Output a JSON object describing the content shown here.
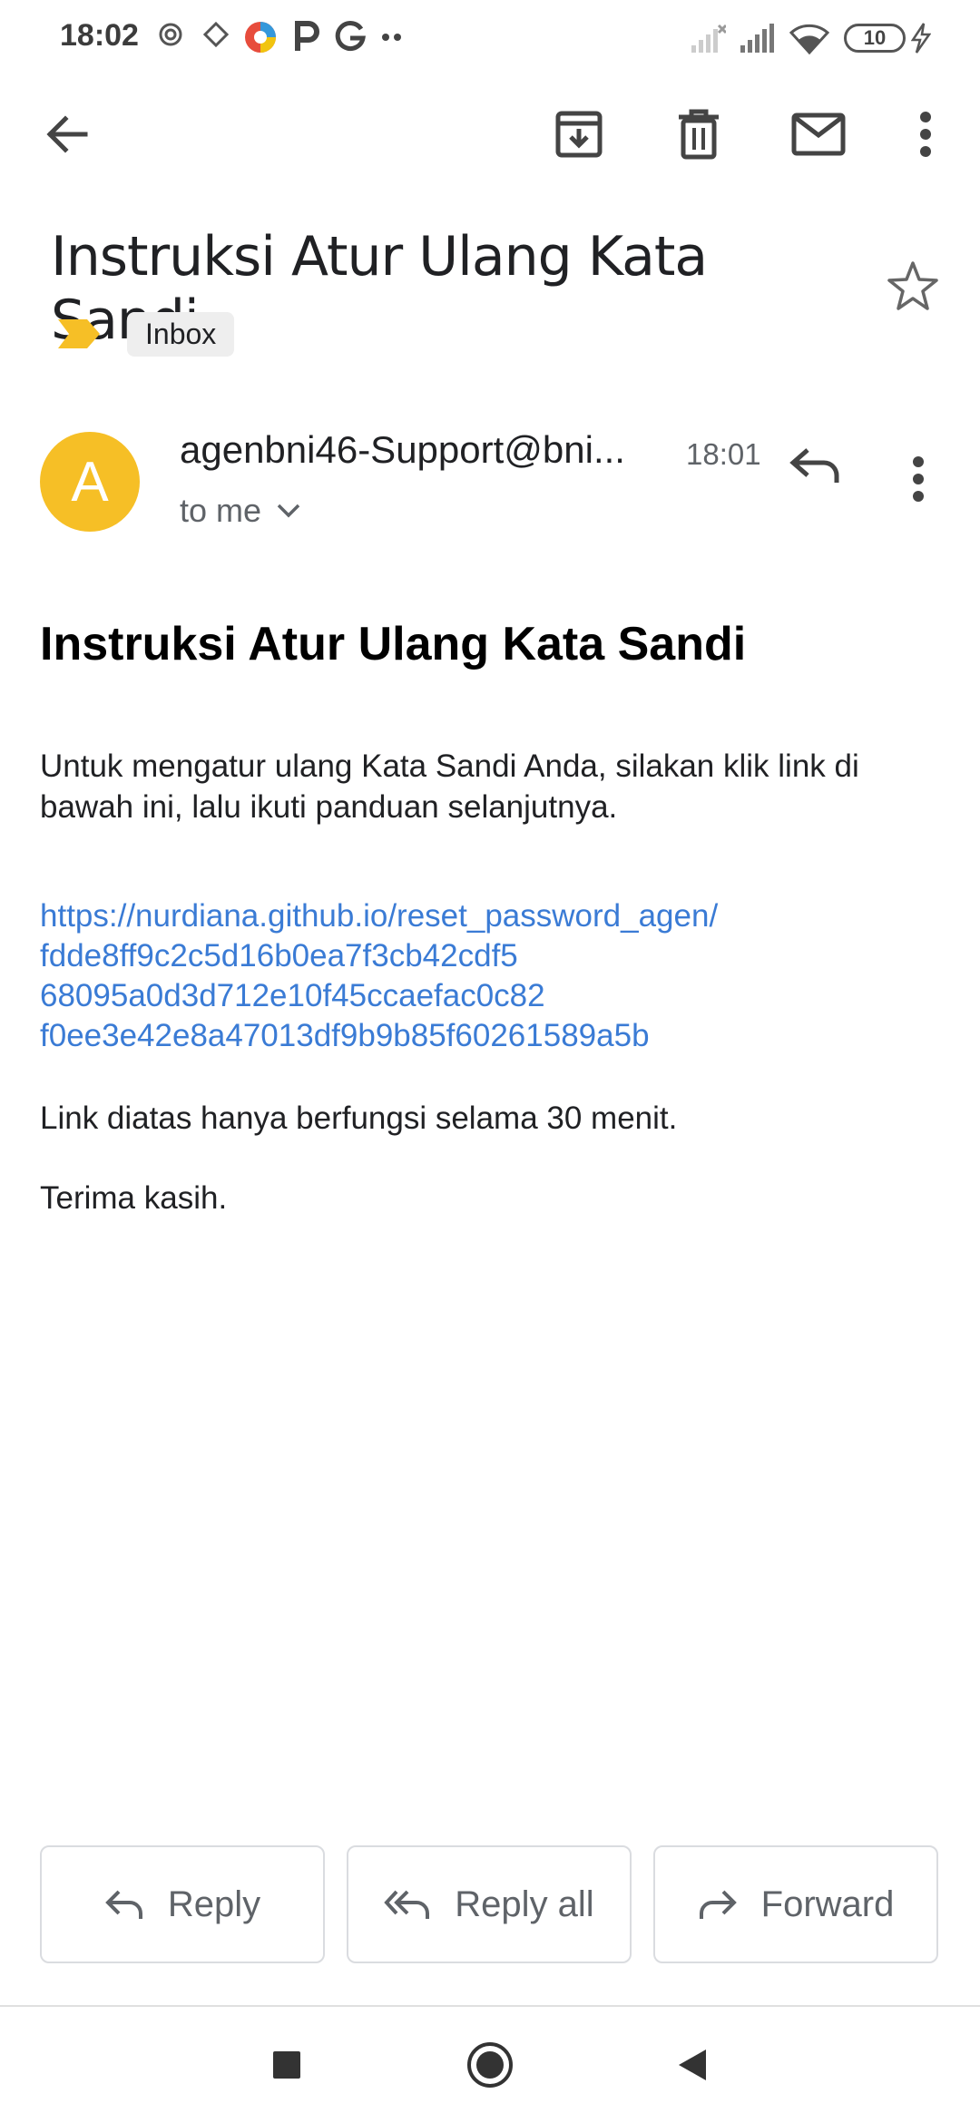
{
  "status_bar": {
    "time": "18:02",
    "battery": "10"
  },
  "toolbar": {
    "icons": [
      "back-arrow-icon",
      "archive-icon",
      "delete-icon",
      "mark-unread-icon",
      "more-vert-icon"
    ]
  },
  "email": {
    "subject": "Instruksi Atur Ulang Kata Sandi",
    "label": "Inbox",
    "sender_initial": "A",
    "sender": "agenbni46-Support@bni...",
    "time": "18:01",
    "recipient": "to me",
    "body_title": "Instruksi Atur Ulang Kata Sandi",
    "paragraph1": "Untuk mengatur ulang Kata Sandi Anda, silakan klik link di bawah ini, lalu ikuti panduan selanjutnya.",
    "link_lines": [
      "https://nurdiana.github.io/reset_password_agen/",
      "fdde8ff9c2c5d16b0ea7f3cb42cdf5",
      "68095a0d3d712e10f45ccaefac0c82",
      "f0ee3e42e8a47013df9b9b85f60261589a5b"
    ],
    "paragraph2": "Link diatas hanya berfungsi selama 30 menit.",
    "paragraph3": "Terima kasih."
  },
  "actions": {
    "reply": "Reply",
    "reply_all": "Reply all",
    "forward": "Forward"
  },
  "colors": {
    "avatar": "#f6bf26",
    "link": "#3a7bd5",
    "important_marker": "#f6bf26"
  }
}
